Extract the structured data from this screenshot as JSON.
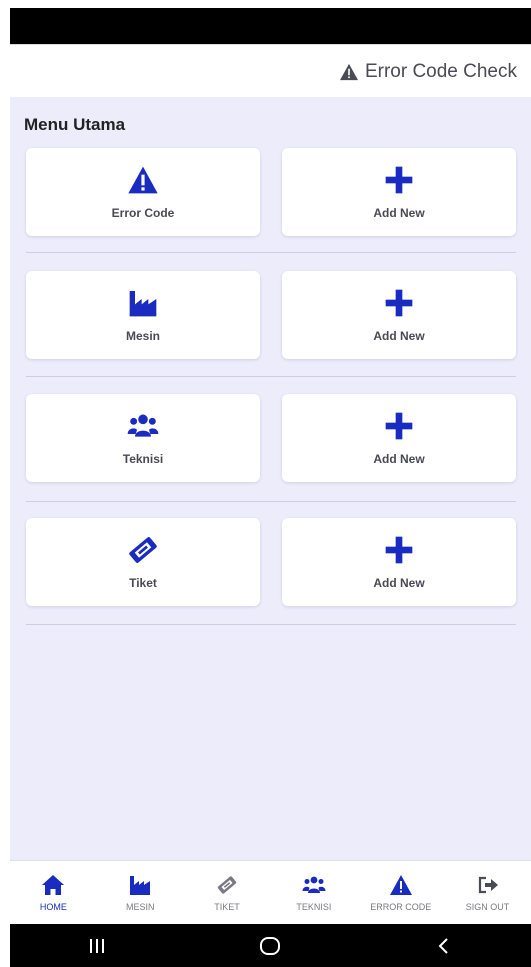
{
  "app_bar": {
    "title": "Error Code Check"
  },
  "main": {
    "section_title": "Menu Utama",
    "rows": [
      {
        "item": {
          "label": "Error Code",
          "icon": "warning-icon"
        },
        "add": {
          "label": "Add New",
          "icon": "plus-icon"
        }
      },
      {
        "item": {
          "label": "Mesin",
          "icon": "factory-icon"
        },
        "add": {
          "label": "Add New",
          "icon": "plus-icon"
        }
      },
      {
        "item": {
          "label": "Teknisi",
          "icon": "users-icon"
        },
        "add": {
          "label": "Add New",
          "icon": "plus-icon"
        }
      },
      {
        "item": {
          "label": "Tiket",
          "icon": "ticket-icon"
        },
        "add": {
          "label": "Add New",
          "icon": "plus-icon"
        }
      }
    ]
  },
  "bottom_nav": {
    "items": [
      {
        "label": "HOME",
        "icon": "home-icon",
        "active": true
      },
      {
        "label": "MESIN",
        "icon": "factory-icon",
        "active": false
      },
      {
        "label": "TIKET",
        "icon": "ticket-icon",
        "active": false
      },
      {
        "label": "TEKNISI",
        "icon": "users-icon",
        "active": false
      },
      {
        "label": "ERROR CODE",
        "icon": "warning-icon",
        "active": false
      },
      {
        "label": "SIGN OUT",
        "icon": "sign-out-icon",
        "active": false
      }
    ]
  },
  "system_nav": {
    "items": [
      "recents-icon",
      "home-circle-icon",
      "back-icon"
    ]
  },
  "colors": {
    "accent": "#1a2bbf",
    "background": "#ececfb",
    "card": "#ffffff",
    "nav_inactive": "#7a7a85"
  }
}
